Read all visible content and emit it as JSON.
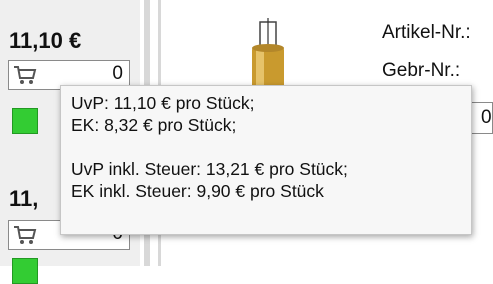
{
  "items": [
    {
      "price": "11,10 €",
      "quantity": "0"
    },
    {
      "price": "11,",
      "quantity": "0"
    }
  ],
  "detail": {
    "article_label": "Artikel-Nr.:",
    "gebr_label": "Gebr-Nr.:",
    "field_value": "0"
  },
  "tooltip": {
    "line1": "UvP: 11,10 € pro Stück;",
    "line2": "EK: 8,32 € pro Stück;",
    "line3": "UvP inkl. Steuer: 13,21 € pro Stück;",
    "line4": "EK inkl. Steuer: 9,90 € pro Stück"
  },
  "colors": {
    "available_green": "#33cc33",
    "panel_gray": "#efefef"
  },
  "icons": {
    "cart": "cart-icon",
    "availability": "availability-indicator-icon"
  }
}
